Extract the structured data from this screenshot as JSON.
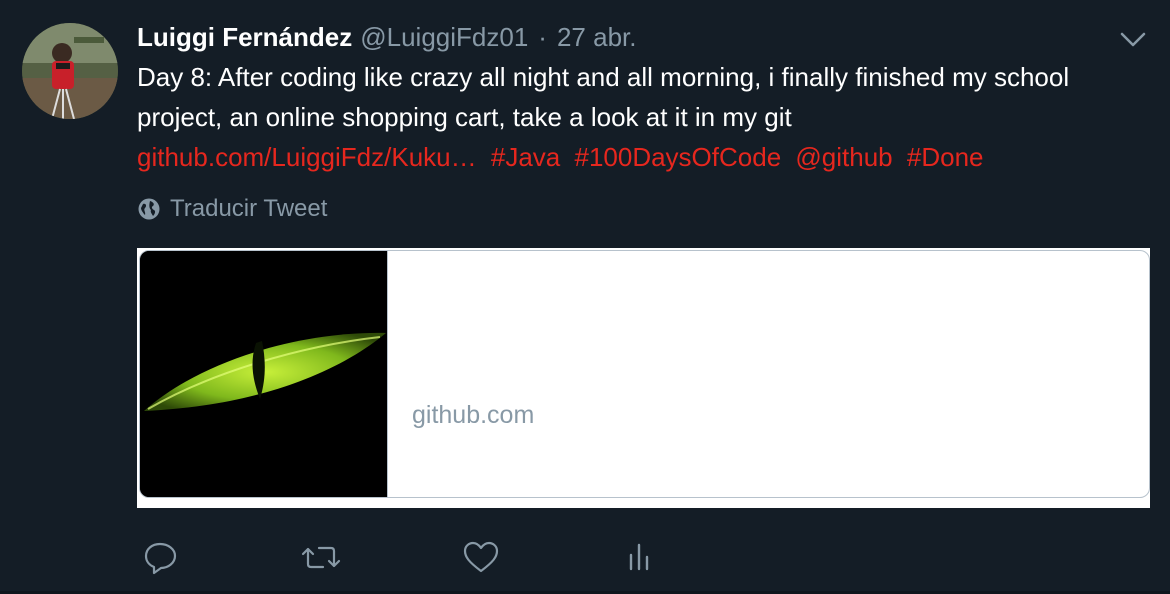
{
  "tweet": {
    "author_name": "Luiggi Fernández",
    "author_handle": "@LuiggiFdz01",
    "separator": "·",
    "date": "27 abr.",
    "text": "Day 8: After coding like crazy all night and all morning, i finally finished my school project, an online shopping cart, take a look at it in my git",
    "link": "github.com/LuiggiFdz/Kuku…",
    "hashtag_java": "#Java",
    "hashtag_100days": "#100DaysOfCode",
    "mention": "@github",
    "hashtag_done": "#Done",
    "translate_label": "Traducir Tweet"
  },
  "card": {
    "domain": "github.com",
    "image_icon": "cat-eye-image"
  },
  "actions": {
    "reply_icon": "reply-icon",
    "retweet_icon": "retweet-icon",
    "like_icon": "heart-icon",
    "analytics_icon": "analytics-icon"
  },
  "colors": {
    "background": "#141d26",
    "text": "#ffffff",
    "muted": "#8899a6",
    "accent": "#e6271e"
  }
}
